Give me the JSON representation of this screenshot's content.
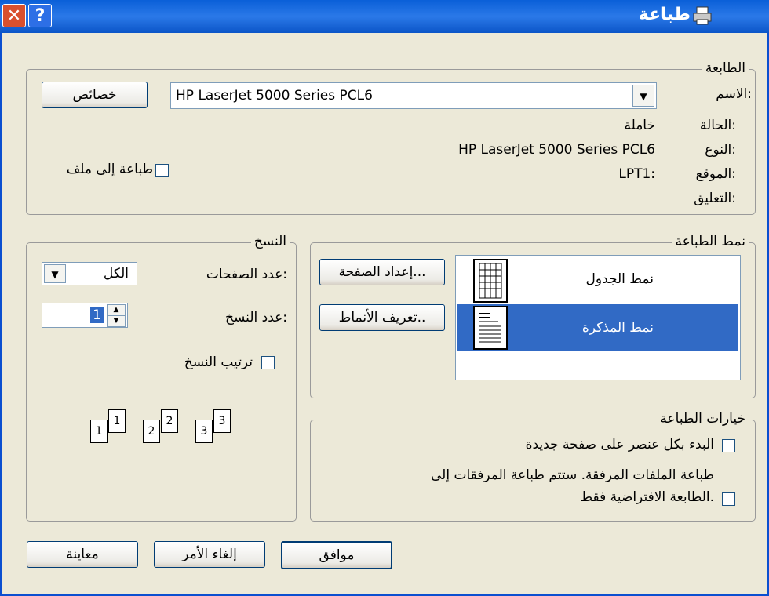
{
  "window": {
    "title": "طباعة",
    "close_glyph": "✕",
    "help_glyph": "?"
  },
  "printer": {
    "legend": "الطابعة",
    "name_label": "الاسم:",
    "name_value": "HP LaserJet 5000 Series PCL6",
    "properties_button": "خصائص",
    "status_label": "الحالة:",
    "status_value": "خاملة",
    "type_label": "النوع:",
    "type_value": "HP LaserJet 5000 Series PCL6",
    "where_label": "الموقع:",
    "where_value": "LPT1:",
    "comment_label": "التعليق:",
    "print_to_file": "طباعة إلى ملف"
  },
  "print_style": {
    "legend": "نمط الطباعة",
    "styles": [
      "نمط الجدول",
      "نمط المذكرة"
    ],
    "selected_index": 1,
    "page_setup_button": "إعداد الصفحة...",
    "define_styles_button": "تعريف الأنماط.."
  },
  "copies": {
    "legend": "النسخ",
    "pages_label": "عدد الصفحات:",
    "pages_value": "الكل",
    "copies_label": "عدد النسخ:",
    "copies_value": "1",
    "collate_label": "ترتيب النسخ",
    "collate_pages": [
      "1",
      "1",
      "2",
      "2",
      "3",
      "3"
    ]
  },
  "print_options": {
    "legend": "خيارات الطباعة",
    "option1": "البدء بكل عنصر على صفحة جديدة",
    "option2_line1": "طباعة الملفات المرفقة. ستتم طباعة المرفقات إلى",
    "option2_line2": "الطابعة الافتراضية فقط."
  },
  "buttons": {
    "ok": "موافق",
    "cancel": "إلغاء الأمر",
    "preview": "معاينة"
  },
  "colors": {
    "titlebar": "#0a5fd8",
    "selection": "#316ac5",
    "dialog_bg": "#ece9d8"
  }
}
